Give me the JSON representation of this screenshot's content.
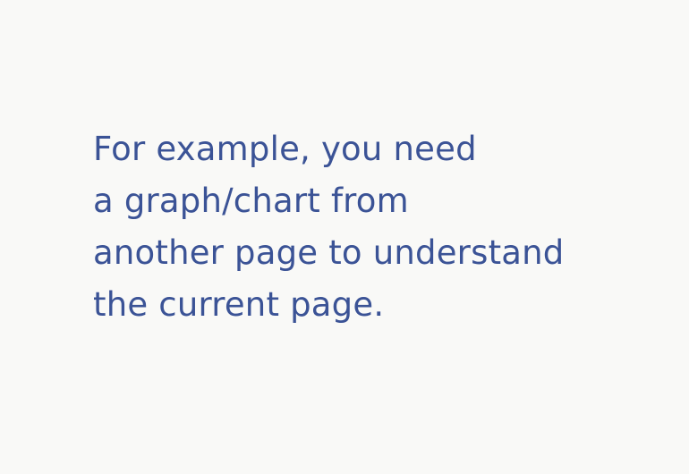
{
  "content": {
    "lines": [
      "For example, you need",
      "a graph/chart from",
      "another page to understand",
      "the current page."
    ]
  }
}
